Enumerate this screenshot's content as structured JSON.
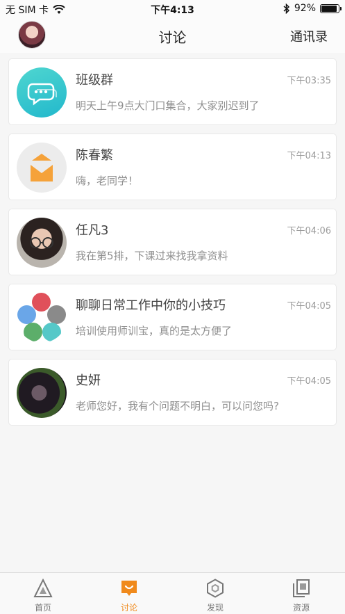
{
  "status_bar": {
    "carrier": "无 SIM 卡",
    "time": "下午4:13",
    "battery": "92%",
    "battery_level": 0.92
  },
  "nav": {
    "title": "讨论",
    "contacts_label": "通讯录"
  },
  "chats": [
    {
      "name": "班级群",
      "time": "下午03:35",
      "message": "明天上午9点大门口集合，大家别迟到了",
      "avatar": "group-chat-icon"
    },
    {
      "name": "陈春繁",
      "time": "下午04:13",
      "message": " 嗨，老同学！",
      "avatar": "default-person-icon"
    },
    {
      "name": "任凡3",
      "time": "下午04:06",
      "message": "我在第5排，下课过来找我拿资料",
      "avatar": "photo"
    },
    {
      "name": "聊聊日常工作中你的小技巧",
      "time": "下午04:05",
      "message": "培训使用师训宝，真的是太方便了",
      "avatar": "multi-avatar"
    },
    {
      "name": "史妍",
      "time": "下午04:05",
      "message": "老师您好，我有个问题不明白，可以问您吗?",
      "avatar": "photo"
    }
  ],
  "tabs": [
    {
      "label": "首页",
      "icon": "home-triangle-icon",
      "active": false
    },
    {
      "label": "讨论",
      "icon": "discussion-icon",
      "active": true
    },
    {
      "label": "发现",
      "icon": "discover-hexagon-icon",
      "active": false
    },
    {
      "label": "资源",
      "icon": "resources-icon",
      "active": false
    }
  ],
  "colors": {
    "accent": "#f08a1c",
    "group_avatar": "#2ec4cc"
  }
}
